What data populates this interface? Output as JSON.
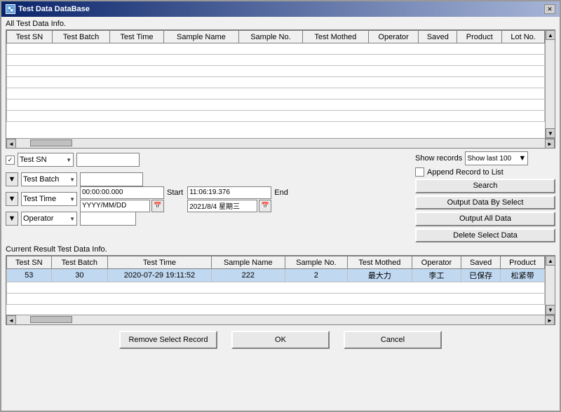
{
  "window": {
    "title": "Test Data DataBase",
    "icon": "db"
  },
  "all_test_data": {
    "label": "All Test Data Info.",
    "columns": [
      "Test SN",
      "Test Batch",
      "Test Time",
      "Sample Name",
      "Sample No.",
      "Test Mothed",
      "Operator",
      "Saved",
      "Product",
      "Lot No."
    ],
    "rows": []
  },
  "filters": {
    "checkbox_checked": "✓",
    "field1_value": "Test SN",
    "field2_value": "Test Batch",
    "field3_value": "Test Time",
    "field4_value": "Operator",
    "datetime_start": "00:00:00.000",
    "datetime_start2": "YYYY/MM/DD",
    "datetime_end": "11:06:19.376",
    "datetime_end2": "2021/8/4 星期三",
    "start_label": "Start",
    "end_label": "End"
  },
  "right_controls": {
    "show_records_label": "Show records",
    "show_records_value": "Show last 100",
    "append_record_label": "Append Record to List",
    "search_label": "Search",
    "output_select_label": "Output Data By Select",
    "output_all_label": "Output All Data",
    "delete_label": "Delete Select Data"
  },
  "current_result": {
    "label": "Current Result Test Data Info.",
    "columns": [
      "Test SN",
      "Test Batch",
      "Test Time",
      "Sample Name",
      "Sample No.",
      "Test Mothed",
      "Operator",
      "Saved",
      "Product"
    ],
    "rows": [
      [
        "53",
        "30",
        "2020-07-29 19:11:52",
        "222",
        "2",
        "最大力",
        "李工",
        "已保存",
        "松紧带"
      ]
    ]
  },
  "bottom_buttons": {
    "remove_label": "Remove Select Record",
    "ok_label": "OK",
    "cancel_label": "Cancel"
  }
}
